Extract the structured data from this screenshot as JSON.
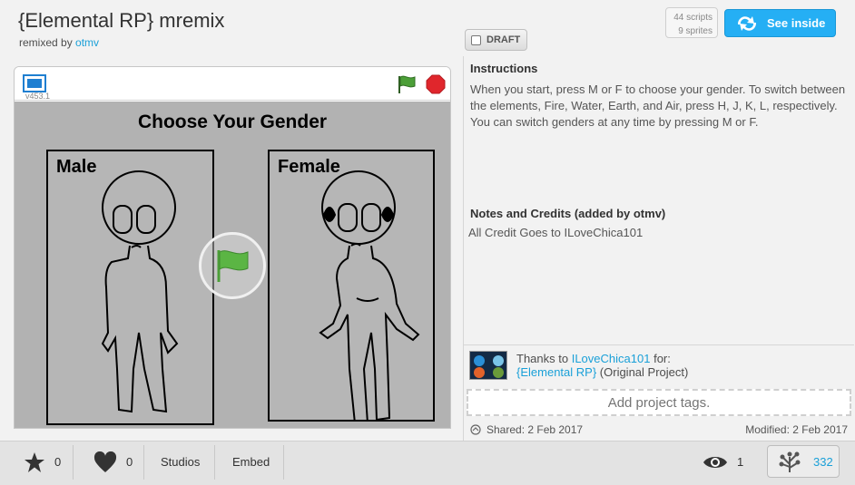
{
  "header": {
    "title": "{Elemental RP} mremix",
    "remixed_prefix": "remixed by",
    "remixed_user": "otmv",
    "draft_label": "DRAFT",
    "scripts_count": "44 scripts",
    "sprites_count": "9 sprites",
    "see_inside_label": "See inside"
  },
  "player": {
    "version": "v453.1",
    "stage_title": "Choose Your Gender",
    "male_label": "Male",
    "female_label": "Female",
    "colors": {
      "flag": "#4c9f38",
      "stop": "#e0262c",
      "stage": "#b2b2b2"
    }
  },
  "info": {
    "instructions_heading": "Instructions",
    "instructions_text": "When you start, press M or F to choose your gender. To switch between the elements, Fire, Water, Earth, and Air, press H, J, K, L, respectively. You can switch genders at any time by pressing M or F.",
    "notes_heading": "Notes and Credits (added by otmv)",
    "notes_text": "All Credit Goes to ILoveChica101",
    "thanks_prefix": "Thanks to",
    "thanks_user": "ILoveChica101",
    "thanks_suffix": "for:",
    "original_project": "{Elemental RP}",
    "original_suffix": "(Original Project)",
    "tags_placeholder": "Add project tags.",
    "shared": "Shared: 2 Feb 2017",
    "modified": "Modified: 2 Feb 2017"
  },
  "footer": {
    "favorites": "0",
    "loves": "0",
    "studios_label": "Studios",
    "embed_label": "Embed",
    "views": "1",
    "remixes": "332"
  }
}
